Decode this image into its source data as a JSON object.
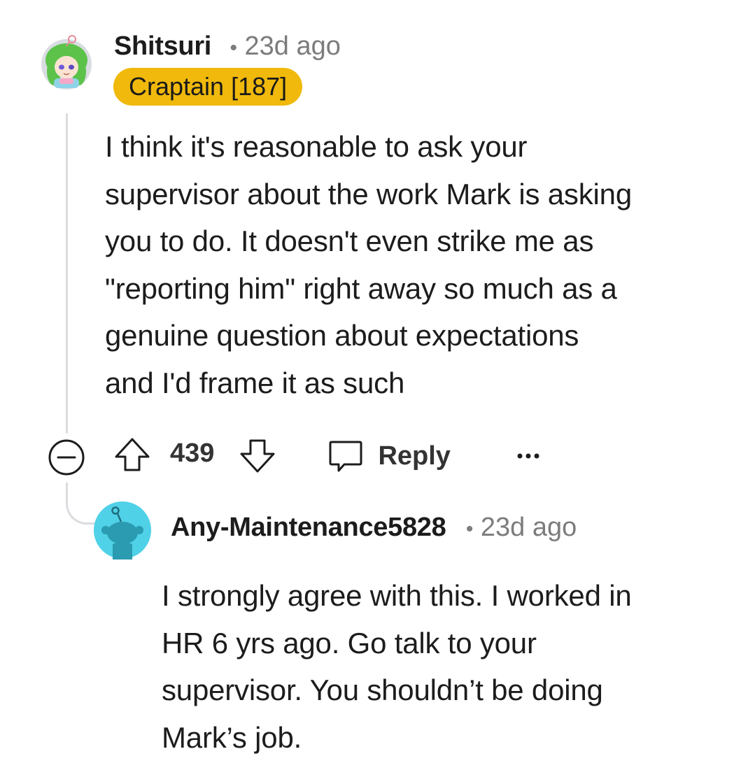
{
  "comment": {
    "username": "Shitsuri",
    "separator": "•",
    "timestamp": "23d ago",
    "flair": "Craptain [187]",
    "body": "I think it's reasonable to ask your\nsupervisor about the work Mark is asking\nyou to do. It doesn't even strike me as\n\"reporting him\" right away so much as a\ngenuine question about expectations\nand I'd frame it as such",
    "actions": {
      "collapse_icon": "collapse-minus-icon",
      "upvote_icon": "upvote-arrow-icon",
      "score": "439",
      "downvote_icon": "downvote-arrow-icon",
      "reply_icon": "comment-bubble-icon",
      "reply_label": "Reply",
      "more_icon": "more-options-icon"
    }
  },
  "reply": {
    "username": "Any-Maintenance5828",
    "separator": "•",
    "timestamp": "23d ago",
    "body": "I strongly agree with this. I worked in\nHR 6 yrs ago. Go talk to your\nsupervisor. You shouldn’t be doing\nMark’s job."
  },
  "colors": {
    "flair_bg": "#f0b90b",
    "reply_avatar_bg": "#4fd1e8",
    "thread_line": "#dadcdf",
    "meta_text": "#7c7c7c"
  }
}
